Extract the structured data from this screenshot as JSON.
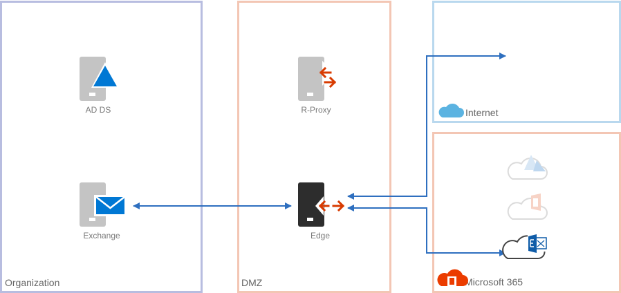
{
  "zones": {
    "organization": {
      "label": "Organization",
      "border_color": "#b8bde0"
    },
    "dmz": {
      "label": "DMZ",
      "border_color": "#f3c6b4"
    },
    "internet": {
      "label": "Internet",
      "border_color": "#b9d8ee"
    },
    "microsoft365": {
      "label": "Microsoft 365",
      "border_color": "#f3c6b4"
    }
  },
  "servers": {
    "adds": {
      "label": "AD DS",
      "icon": "triangle-icon"
    },
    "exchange": {
      "label": "Exchange",
      "icon": "mail-icon"
    },
    "rproxy": {
      "label": "R-Proxy",
      "icon": "arrows-icon"
    },
    "edge": {
      "label": "Edge",
      "icon": "arrows-icon"
    }
  },
  "colors": {
    "server_gray": "#c4c4c4",
    "server_dark": "#2d2d2d",
    "azure_blue": "#0078d4",
    "arrow_orange": "#d83b01",
    "connector_blue": "#2e6fbf",
    "cloud_blue": "#5bb3e1",
    "office_red": "#eb3c00"
  }
}
